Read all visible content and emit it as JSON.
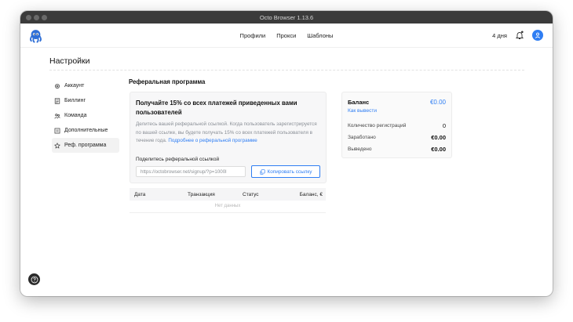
{
  "window": {
    "title": "Octo Browser 1.13.6"
  },
  "nav": {
    "links": [
      "Профили",
      "Прокси",
      "Шаблоны"
    ],
    "days": "4 дня"
  },
  "page": {
    "title": "Настройки"
  },
  "sidebar": {
    "items": [
      {
        "label": "Аккаунт",
        "icon": "gear-icon"
      },
      {
        "label": "Биллинг",
        "icon": "billing-icon"
      },
      {
        "label": "Команда",
        "icon": "team-icon"
      },
      {
        "label": "Дополнительные",
        "icon": "sliders-icon"
      },
      {
        "label": "Реф. программа",
        "icon": "star-icon"
      }
    ],
    "active_index": 4
  },
  "referral": {
    "section_title": "Реферальная программа",
    "heading": "Получайте 15% со всех платежей приведенных вами пользователей",
    "description": "Делитесь вашей реферальной ссылкой. Когда пользователь зарегистрируется по вашей ссылке, вы будете получать 15% со всех платежей пользователя в течение года.",
    "more_link": "Подробнее о реферальной программе",
    "share_label": "Поделитесь реферальной ссылкой",
    "link_value": "https://octobrowser.net/signup/?p=1000l",
    "copy_button": "Копировать ссылку"
  },
  "table": {
    "headers": [
      "Дата",
      "Транзакция",
      "Статус",
      "Баланс, €"
    ],
    "empty_text": "Нет данных"
  },
  "balance": {
    "title": "Баланс",
    "amount": "€0.00",
    "withdraw_link": "Как вывести",
    "rows": [
      {
        "label": "Количество регистраций",
        "value": "0"
      },
      {
        "label": "Заработано",
        "value": "€0.00"
      },
      {
        "label": "Выведено",
        "value": "€0.00"
      }
    ]
  },
  "colors": {
    "accent": "#2f7ef3",
    "titlebar": "#3b3b3b"
  }
}
